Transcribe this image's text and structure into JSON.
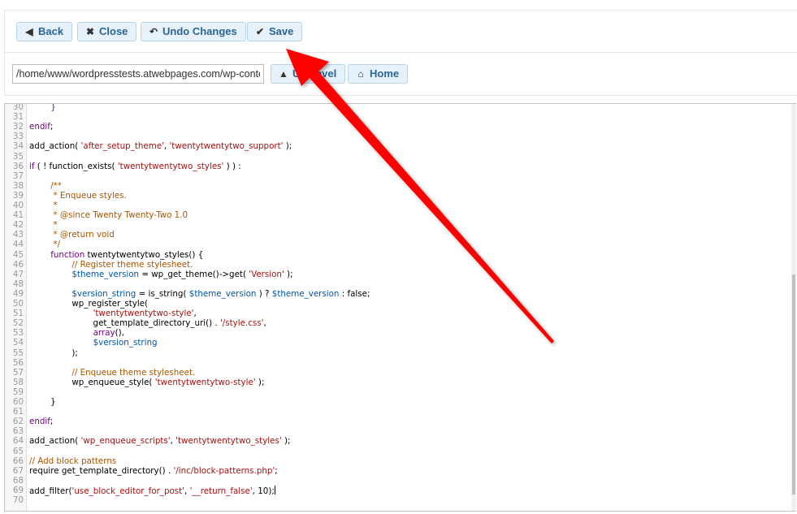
{
  "toolbar": {
    "buttons": [
      {
        "label": "Back",
        "icon": "arrow-left-icon"
      },
      {
        "label": "Close",
        "icon": "close-icon"
      },
      {
        "label": "Undo Changes",
        "icon": "undo-icon"
      },
      {
        "label": "Save",
        "icon": "check-circle-icon"
      }
    ]
  },
  "pathbar": {
    "path_value": "/home/www/wordpresstests.atwebpages.com/wp-conten",
    "up_level_label": "Up Level",
    "home_label": "Home"
  },
  "editor": {
    "first_line": 30,
    "scroll_fraction_start": 0.42,
    "scroll_fraction_end": 0.96,
    "lines": [
      {
        "n": "30",
        "html": "        <span class=\"var\">}</span>"
      },
      {
        "n": "31",
        "html": ""
      },
      {
        "n": "32",
        "html": "<span class=\"kw\">endif</span>;"
      },
      {
        "n": "33",
        "html": ""
      },
      {
        "n": "34",
        "html": "add_action( <span class=\"str\">'after_setup_theme'</span>, <span class=\"str\">'twentytwentytwo_support'</span> );"
      },
      {
        "n": "35",
        "html": ""
      },
      {
        "n": "36",
        "html": "<span class=\"kw\">if</span> ( ! function_exists( <span class=\"str\">'twentytwentytwo_styles'</span> ) ) :"
      },
      {
        "n": "37",
        "html": ""
      },
      {
        "n": "38",
        "html": "        <span class=\"com\">/**</span>"
      },
      {
        "n": "39",
        "html": "         <span class=\"com\">* Enqueue styles.</span>"
      },
      {
        "n": "40",
        "html": "         <span class=\"com\">*</span>"
      },
      {
        "n": "41",
        "html": "         <span class=\"com\">* @since Twenty Twenty-Two 1.0</span>"
      },
      {
        "n": "42",
        "html": "         <span class=\"com\">*</span>"
      },
      {
        "n": "43",
        "html": "         <span class=\"com\">* @return void</span>"
      },
      {
        "n": "44",
        "html": "         <span class=\"com\">*/</span>"
      },
      {
        "n": "45",
        "html": "        <span class=\"kw\">function</span> twentytwentytwo_styles() {"
      },
      {
        "n": "46",
        "html": "                <span class=\"com\">// Register theme stylesheet.</span>"
      },
      {
        "n": "47",
        "html": "                <span class=\"var\">$theme_version</span> = wp_get_theme()-&gt;get( <span class=\"str\">'Version'</span> );"
      },
      {
        "n": "48",
        "html": ""
      },
      {
        "n": "49",
        "html": "                <span class=\"var\">$version_string</span> = is_string( <span class=\"var\">$theme_version</span> ) ? <span class=\"var\">$theme_version</span> : false;"
      },
      {
        "n": "50",
        "html": "                wp_register_style("
      },
      {
        "n": "51",
        "html": "                        <span class=\"str\">'twentytwentytwo-style'</span>,"
      },
      {
        "n": "52",
        "html": "                        get_template_directory_uri() . <span class=\"str\">'/style.css'</span>,"
      },
      {
        "n": "53",
        "html": "                        <span class=\"kw\">array</span>(),"
      },
      {
        "n": "54",
        "html": "                        <span class=\"var\">$version_string</span>"
      },
      {
        "n": "55",
        "html": "                );"
      },
      {
        "n": "56",
        "html": ""
      },
      {
        "n": "57",
        "html": "                <span class=\"com\">// Enqueue theme stylesheet.</span>"
      },
      {
        "n": "58",
        "html": "                wp_enqueue_style( <span class=\"str\">'twentytwentytwo-style'</span> );"
      },
      {
        "n": "59",
        "html": ""
      },
      {
        "n": "60",
        "html": "        }"
      },
      {
        "n": "61",
        "html": ""
      },
      {
        "n": "62",
        "html": "<span class=\"kw\">endif</span>;"
      },
      {
        "n": "63",
        "html": ""
      },
      {
        "n": "64",
        "html": "add_action( <span class=\"str\">'wp_enqueue_scripts'</span>, <span class=\"str\">'twentytwentytwo_styles'</span> );"
      },
      {
        "n": "65",
        "html": ""
      },
      {
        "n": "66",
        "html": "<span class=\"com\">// Add block patterns</span>"
      },
      {
        "n": "67",
        "html": "require get_template_directory() . <span class=\"str\">'/inc/block-patterns.php'</span>;"
      },
      {
        "n": "68",
        "html": ""
      },
      {
        "n": "69",
        "html": "add_filter(<span class=\"str\">'use_block_editor_for_post'</span>, <span class=\"str\">'__return_false'</span>, 10);<span id=\"cursor\" data-name=\"text-cursor\" data-interactable=\"false\"></span>"
      },
      {
        "n": "70",
        "html": ""
      }
    ]
  },
  "annotation": {
    "type": "arrow",
    "color": "#ff0000",
    "points_to": "save-button"
  },
  "colors": {
    "button_text": "#2a6496",
    "button_border": "#b8d4ea",
    "keyword": "#770088",
    "string": "#aa1111",
    "comment": "#aa5500",
    "variable": "#0055aa"
  }
}
